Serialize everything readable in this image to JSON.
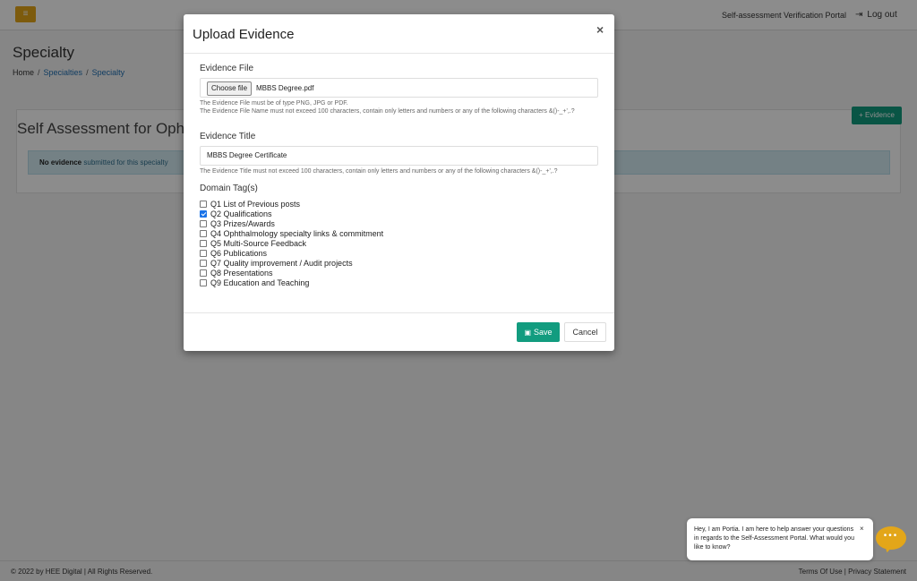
{
  "topbar": {
    "menu_icon": "hamburger-icon",
    "portal_title": "Self-assessment Verification Portal",
    "logout_icon": "sign-out-icon",
    "logout_label": "Log out"
  },
  "page": {
    "title": "Specialty",
    "breadcrumb": [
      "Home",
      "Specialties",
      "Specialty"
    ],
    "card_title": "Self Assessment for Ophthalm",
    "evidence_button": "+ Evidence",
    "alert_bold": "No evidence",
    "alert_rest": " submitted for this specialty"
  },
  "modal": {
    "title": "Upload Evidence",
    "close": "×",
    "file_label": "Evidence File",
    "choose_button": "Choose file",
    "file_name": "MBBS Degree.pdf",
    "file_help": "The Evidence File must be of type PNG, JPG or PDF.\nThe Evidence File Name must not exceed 100 characters, contain only letters and numbers or any of the following characters &()-_+',.?",
    "title_label": "Evidence Title",
    "title_value": "MBBS Degree Certificate",
    "title_help": "The Evidence Title must not exceed 100 characters, contain only letters and numbers or any of the following characters &()-_+',.?",
    "tags_label": "Domain Tag(s)",
    "tags": [
      {
        "label": "Q1 List of Previous posts",
        "checked": false
      },
      {
        "label": "Q2 Qualifications",
        "checked": true
      },
      {
        "label": "Q3 Prizes/Awards",
        "checked": false
      },
      {
        "label": "Q4 Ophthalmology specialty links & commitment",
        "checked": false
      },
      {
        "label": "Q5 Multi-Source Feedback",
        "checked": false
      },
      {
        "label": "Q6 Publications",
        "checked": false
      },
      {
        "label": "Q7 Quality improvement / Audit projects",
        "checked": false
      },
      {
        "label": "Q8 Presentations",
        "checked": false
      },
      {
        "label": "Q9 Education and Teaching",
        "checked": false
      }
    ],
    "save_label": "Save",
    "cancel_label": "Cancel"
  },
  "chat": {
    "message": "Hey, I am Portia. I am here to help answer your questions in regards to the Self-Assessment Portal. What would you like to know?",
    "close": "×"
  },
  "footer": {
    "copyright": "© 2022 by HEE Digital | All Rights Reserved.",
    "terms": "Terms Of Use",
    "sep": "|",
    "privacy": "Privacy Statement"
  },
  "colors": {
    "accent_green": "#129c7f",
    "menu_yellow": "#e3a619",
    "link_blue": "#1f6fb2",
    "alert_bg": "#d3ecf3"
  }
}
